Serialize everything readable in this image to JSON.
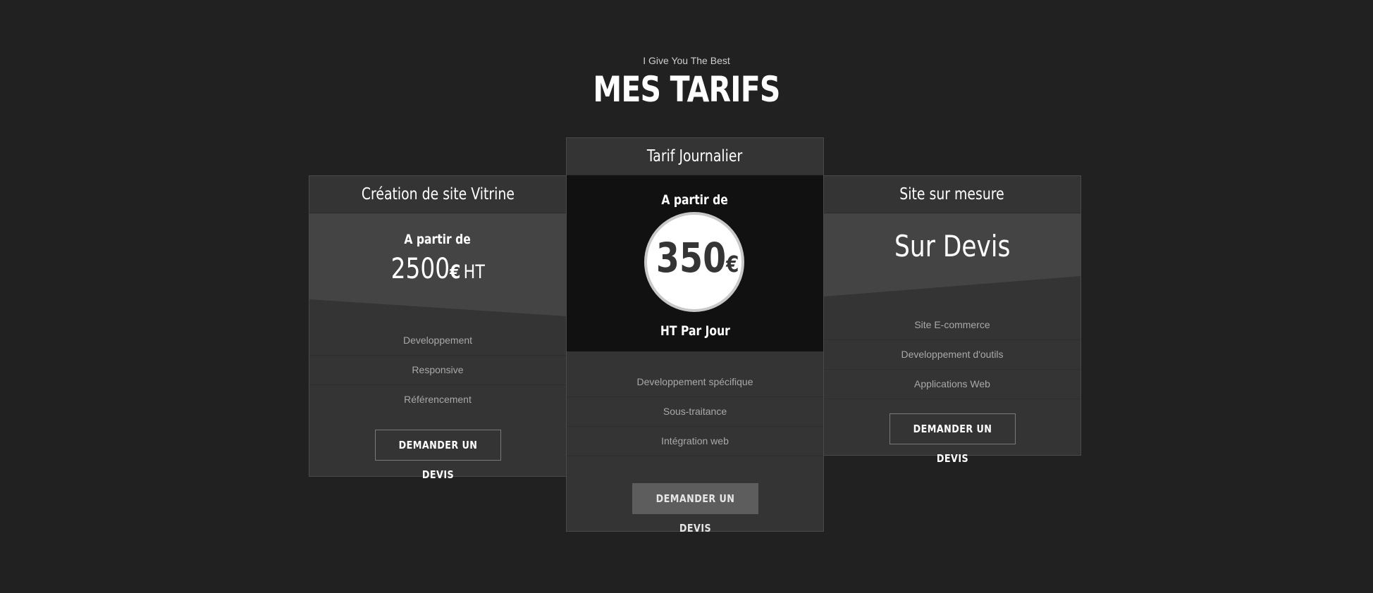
{
  "header": {
    "subtitle": "I Give You The Best",
    "title": "MES TARIFS"
  },
  "cards": [
    {
      "name": "Création de site Vitrine",
      "from_label": "A partir de",
      "price": "2500",
      "currency": "€",
      "suffix": "HT",
      "features": [
        "Developpement",
        "Responsive",
        "Référencement"
      ],
      "button": "DEMANDER UN DEVIS"
    },
    {
      "name": "Tarif Journalier",
      "from_label": "A partir de",
      "price": "350",
      "currency": "€",
      "suffix": "HT Par Jour",
      "features": [
        "Developpement spécifique",
        "Sous-traitance",
        "Intégration web"
      ],
      "button": "DEMANDER UN DEVIS"
    },
    {
      "name": "Site sur mesure",
      "price_text": "Sur Devis",
      "features": [
        "Site E-commerce",
        "Developpement d'outils",
        "Applications Web"
      ],
      "button": "DEMANDER UN DEVIS"
    }
  ],
  "colors": {
    "background": "#212121",
    "card": "#343434",
    "highlight": "#111111",
    "circle": "#ffffff",
    "button_filled": "#5d5d5d"
  }
}
